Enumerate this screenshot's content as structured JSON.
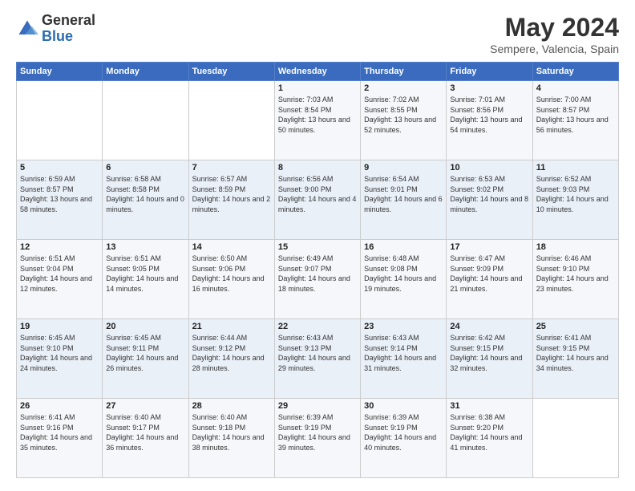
{
  "logo": {
    "general": "General",
    "blue": "Blue"
  },
  "title": {
    "month": "May 2024",
    "location": "Sempere, Valencia, Spain"
  },
  "weekdays": [
    "Sunday",
    "Monday",
    "Tuesday",
    "Wednesday",
    "Thursday",
    "Friday",
    "Saturday"
  ],
  "weeks": [
    [
      {
        "day": "",
        "sunrise": "",
        "sunset": "",
        "daylight": ""
      },
      {
        "day": "",
        "sunrise": "",
        "sunset": "",
        "daylight": ""
      },
      {
        "day": "",
        "sunrise": "",
        "sunset": "",
        "daylight": ""
      },
      {
        "day": "1",
        "sunrise": "Sunrise: 7:03 AM",
        "sunset": "Sunset: 8:54 PM",
        "daylight": "Daylight: 13 hours and 50 minutes."
      },
      {
        "day": "2",
        "sunrise": "Sunrise: 7:02 AM",
        "sunset": "Sunset: 8:55 PM",
        "daylight": "Daylight: 13 hours and 52 minutes."
      },
      {
        "day": "3",
        "sunrise": "Sunrise: 7:01 AM",
        "sunset": "Sunset: 8:56 PM",
        "daylight": "Daylight: 13 hours and 54 minutes."
      },
      {
        "day": "4",
        "sunrise": "Sunrise: 7:00 AM",
        "sunset": "Sunset: 8:57 PM",
        "daylight": "Daylight: 13 hours and 56 minutes."
      }
    ],
    [
      {
        "day": "5",
        "sunrise": "Sunrise: 6:59 AM",
        "sunset": "Sunset: 8:57 PM",
        "daylight": "Daylight: 13 hours and 58 minutes."
      },
      {
        "day": "6",
        "sunrise": "Sunrise: 6:58 AM",
        "sunset": "Sunset: 8:58 PM",
        "daylight": "Daylight: 14 hours and 0 minutes."
      },
      {
        "day": "7",
        "sunrise": "Sunrise: 6:57 AM",
        "sunset": "Sunset: 8:59 PM",
        "daylight": "Daylight: 14 hours and 2 minutes."
      },
      {
        "day": "8",
        "sunrise": "Sunrise: 6:56 AM",
        "sunset": "Sunset: 9:00 PM",
        "daylight": "Daylight: 14 hours and 4 minutes."
      },
      {
        "day": "9",
        "sunrise": "Sunrise: 6:54 AM",
        "sunset": "Sunset: 9:01 PM",
        "daylight": "Daylight: 14 hours and 6 minutes."
      },
      {
        "day": "10",
        "sunrise": "Sunrise: 6:53 AM",
        "sunset": "Sunset: 9:02 PM",
        "daylight": "Daylight: 14 hours and 8 minutes."
      },
      {
        "day": "11",
        "sunrise": "Sunrise: 6:52 AM",
        "sunset": "Sunset: 9:03 PM",
        "daylight": "Daylight: 14 hours and 10 minutes."
      }
    ],
    [
      {
        "day": "12",
        "sunrise": "Sunrise: 6:51 AM",
        "sunset": "Sunset: 9:04 PM",
        "daylight": "Daylight: 14 hours and 12 minutes."
      },
      {
        "day": "13",
        "sunrise": "Sunrise: 6:51 AM",
        "sunset": "Sunset: 9:05 PM",
        "daylight": "Daylight: 14 hours and 14 minutes."
      },
      {
        "day": "14",
        "sunrise": "Sunrise: 6:50 AM",
        "sunset": "Sunset: 9:06 PM",
        "daylight": "Daylight: 14 hours and 16 minutes."
      },
      {
        "day": "15",
        "sunrise": "Sunrise: 6:49 AM",
        "sunset": "Sunset: 9:07 PM",
        "daylight": "Daylight: 14 hours and 18 minutes."
      },
      {
        "day": "16",
        "sunrise": "Sunrise: 6:48 AM",
        "sunset": "Sunset: 9:08 PM",
        "daylight": "Daylight: 14 hours and 19 minutes."
      },
      {
        "day": "17",
        "sunrise": "Sunrise: 6:47 AM",
        "sunset": "Sunset: 9:09 PM",
        "daylight": "Daylight: 14 hours and 21 minutes."
      },
      {
        "day": "18",
        "sunrise": "Sunrise: 6:46 AM",
        "sunset": "Sunset: 9:10 PM",
        "daylight": "Daylight: 14 hours and 23 minutes."
      }
    ],
    [
      {
        "day": "19",
        "sunrise": "Sunrise: 6:45 AM",
        "sunset": "Sunset: 9:10 PM",
        "daylight": "Daylight: 14 hours and 24 minutes."
      },
      {
        "day": "20",
        "sunrise": "Sunrise: 6:45 AM",
        "sunset": "Sunset: 9:11 PM",
        "daylight": "Daylight: 14 hours and 26 minutes."
      },
      {
        "day": "21",
        "sunrise": "Sunrise: 6:44 AM",
        "sunset": "Sunset: 9:12 PM",
        "daylight": "Daylight: 14 hours and 28 minutes."
      },
      {
        "day": "22",
        "sunrise": "Sunrise: 6:43 AM",
        "sunset": "Sunset: 9:13 PM",
        "daylight": "Daylight: 14 hours and 29 minutes."
      },
      {
        "day": "23",
        "sunrise": "Sunrise: 6:43 AM",
        "sunset": "Sunset: 9:14 PM",
        "daylight": "Daylight: 14 hours and 31 minutes."
      },
      {
        "day": "24",
        "sunrise": "Sunrise: 6:42 AM",
        "sunset": "Sunset: 9:15 PM",
        "daylight": "Daylight: 14 hours and 32 minutes."
      },
      {
        "day": "25",
        "sunrise": "Sunrise: 6:41 AM",
        "sunset": "Sunset: 9:15 PM",
        "daylight": "Daylight: 14 hours and 34 minutes."
      }
    ],
    [
      {
        "day": "26",
        "sunrise": "Sunrise: 6:41 AM",
        "sunset": "Sunset: 9:16 PM",
        "daylight": "Daylight: 14 hours and 35 minutes."
      },
      {
        "day": "27",
        "sunrise": "Sunrise: 6:40 AM",
        "sunset": "Sunset: 9:17 PM",
        "daylight": "Daylight: 14 hours and 36 minutes."
      },
      {
        "day": "28",
        "sunrise": "Sunrise: 6:40 AM",
        "sunset": "Sunset: 9:18 PM",
        "daylight": "Daylight: 14 hours and 38 minutes."
      },
      {
        "day": "29",
        "sunrise": "Sunrise: 6:39 AM",
        "sunset": "Sunset: 9:19 PM",
        "daylight": "Daylight: 14 hours and 39 minutes."
      },
      {
        "day": "30",
        "sunrise": "Sunrise: 6:39 AM",
        "sunset": "Sunset: 9:19 PM",
        "daylight": "Daylight: 14 hours and 40 minutes."
      },
      {
        "day": "31",
        "sunrise": "Sunrise: 6:38 AM",
        "sunset": "Sunset: 9:20 PM",
        "daylight": "Daylight: 14 hours and 41 minutes."
      },
      {
        "day": "",
        "sunrise": "",
        "sunset": "",
        "daylight": ""
      }
    ]
  ]
}
